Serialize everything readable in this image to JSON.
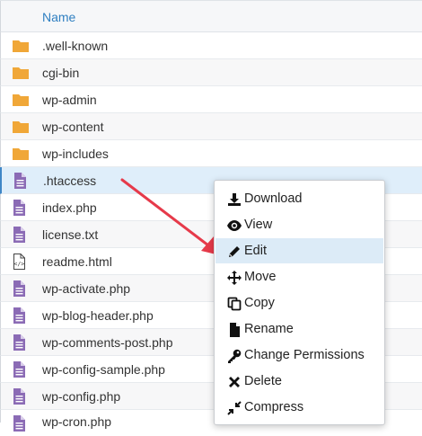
{
  "table": {
    "header": {
      "name_label": "Name"
    },
    "rows": [
      {
        "name": ".well-known",
        "icon": "folder-icon"
      },
      {
        "name": "cgi-bin",
        "icon": "folder-icon"
      },
      {
        "name": "wp-admin",
        "icon": "folder-icon"
      },
      {
        "name": "wp-content",
        "icon": "folder-icon"
      },
      {
        "name": "wp-includes",
        "icon": "folder-icon"
      },
      {
        "name": ".htaccess",
        "icon": "text-file-icon",
        "selected": true
      },
      {
        "name": "index.php",
        "icon": "text-file-icon"
      },
      {
        "name": "license.txt",
        "icon": "text-file-icon"
      },
      {
        "name": "readme.html",
        "icon": "code-file-icon"
      },
      {
        "name": "wp-activate.php",
        "icon": "text-file-icon"
      },
      {
        "name": "wp-blog-header.php",
        "icon": "text-file-icon"
      },
      {
        "name": "wp-comments-post.php",
        "icon": "text-file-icon"
      },
      {
        "name": "wp-config-sample.php",
        "icon": "text-file-icon"
      },
      {
        "name": "wp-config.php",
        "icon": "text-file-icon"
      },
      {
        "name": "wp-cron.php",
        "icon": "text-file-icon",
        "partially_visible": true
      }
    ]
  },
  "context_menu": {
    "items": [
      {
        "label": "Download",
        "icon": "download-icon"
      },
      {
        "label": "View",
        "icon": "eye-icon"
      },
      {
        "label": "Edit",
        "icon": "pencil-icon",
        "highlighted": true
      },
      {
        "label": "Move",
        "icon": "move-arrows-icon"
      },
      {
        "label": "Copy",
        "icon": "copy-icon"
      },
      {
        "label": "Rename",
        "icon": "rename-file-icon"
      },
      {
        "label": "Change Permissions",
        "icon": "key-icon"
      },
      {
        "label": "Delete",
        "icon": "delete-x-icon"
      },
      {
        "label": "Compress",
        "icon": "compress-icon"
      }
    ]
  },
  "colors": {
    "header_text": "#2f7fc1",
    "folder": "#f0a738",
    "file": "#8b6bb5",
    "selected_row": "#dfeefa",
    "menu_highlight": "#dcebf7",
    "annotation_arrow": "#e63a4a"
  }
}
